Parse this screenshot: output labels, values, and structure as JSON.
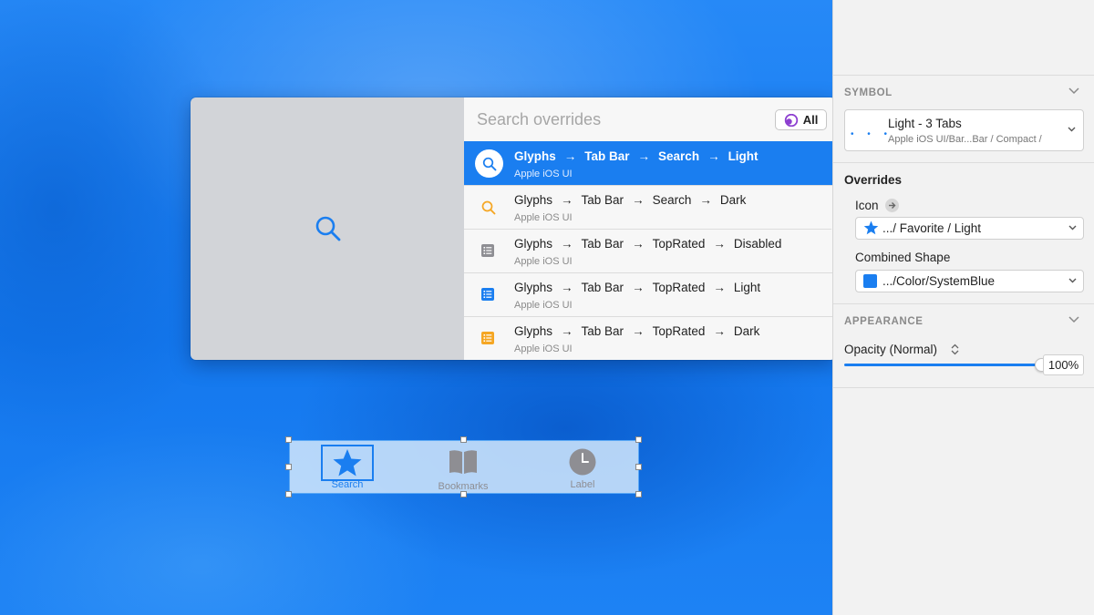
{
  "popover": {
    "search_placeholder": "Search overrides",
    "filter_label": "All",
    "results": [
      {
        "parts": [
          "Glyphs",
          "Tab Bar",
          "Search",
          "Light"
        ],
        "library": "Apple iOS UI",
        "icon": "search-icon",
        "icon_color": "#1a7ef0",
        "selected": true
      },
      {
        "parts": [
          "Glyphs",
          "Tab Bar",
          "Search",
          "Dark"
        ],
        "library": "Apple iOS UI",
        "icon": "search-icon",
        "icon_color": "#f5a623",
        "selected": false
      },
      {
        "parts": [
          "Glyphs",
          "Tab Bar",
          "TopRated",
          "Disabled"
        ],
        "library": "Apple iOS UI",
        "icon": "list-icon",
        "icon_color": "#8e8e93",
        "selected": false
      },
      {
        "parts": [
          "Glyphs",
          "Tab Bar",
          "TopRated",
          "Light"
        ],
        "library": "Apple iOS UI",
        "icon": "list-icon",
        "icon_color": "#1a7ef0",
        "selected": false
      },
      {
        "parts": [
          "Glyphs",
          "Tab Bar",
          "TopRated",
          "Dark"
        ],
        "library": "Apple iOS UI",
        "icon": "list-icon",
        "icon_color": "#f5a623",
        "selected": false
      }
    ]
  },
  "tabbar": {
    "tabs": [
      {
        "label": "Search",
        "icon": "star-icon",
        "color": "#1a7ef0"
      },
      {
        "label": "Bookmarks",
        "icon": "book-icon",
        "color": "#8e8e93"
      },
      {
        "label": "Label",
        "icon": "clock-icon",
        "color": "#8e8e93"
      }
    ]
  },
  "inspector": {
    "symbol_heading": "SYMBOL",
    "symbol_name": "Light - 3 Tabs",
    "symbol_path": "Apple iOS UI/Bar...Bar / Compact /",
    "overrides_heading": "Overrides",
    "icon_label": "Icon",
    "icon_value": ".../ Favorite / Light",
    "combined_shape_label": "Combined Shape",
    "combined_shape_value": ".../Color/SystemBlue",
    "appearance_heading": "APPEARANCE",
    "opacity_label": "Opacity (Normal)",
    "opacity_value": "100%",
    "opacity_level": 1.0
  },
  "colors": {
    "accent": "#1a7ef0",
    "canvas": "#1a7ef2"
  }
}
